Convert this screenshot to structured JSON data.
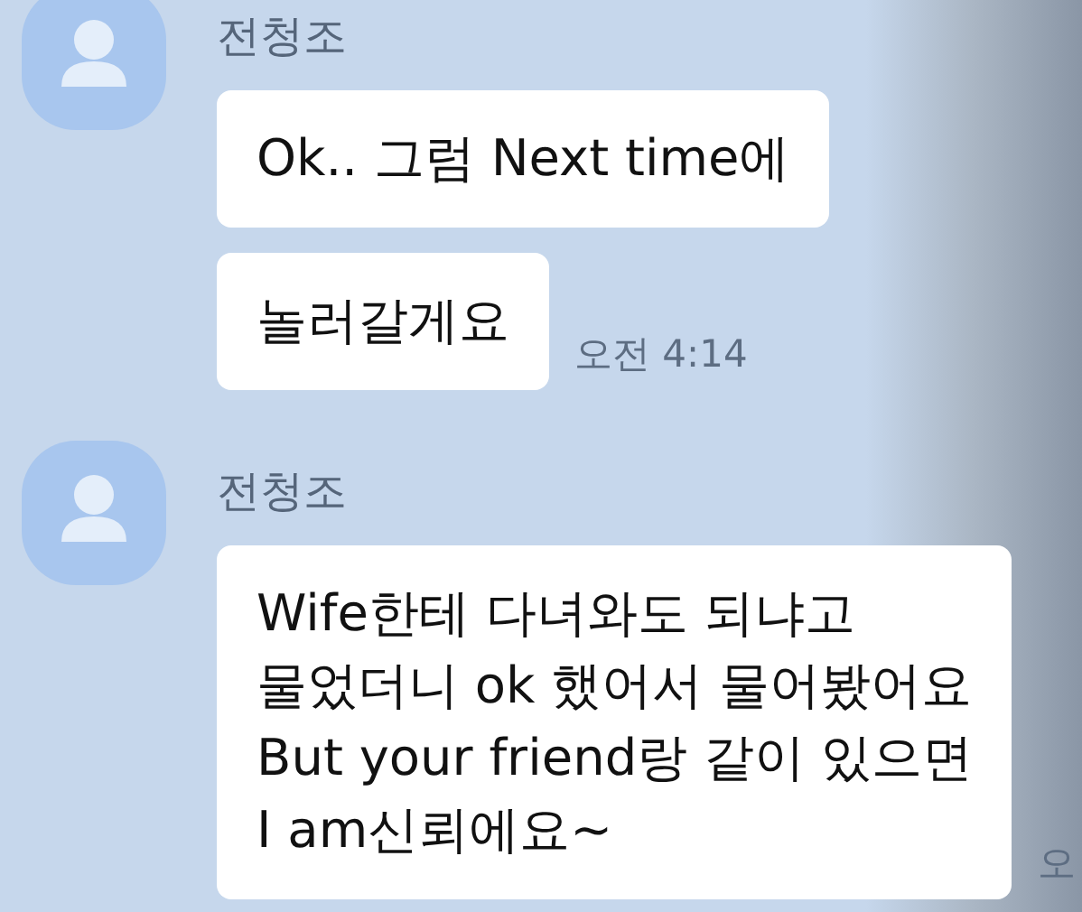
{
  "groups": [
    {
      "sender": "전청조",
      "messages": [
        {
          "text": "Ok.. 그럼 Next time에"
        },
        {
          "text": "놀러갈게요"
        }
      ],
      "time": "오전 4:14"
    },
    {
      "sender": "전청조",
      "messages": [
        {
          "text": "Wife한테 다녀와도 되냐고\n물었더니 ok 했어서 물어봤어요\nBut your friend랑 같이 있으면\nI am신뢰에요~"
        }
      ],
      "time": "오"
    }
  ]
}
